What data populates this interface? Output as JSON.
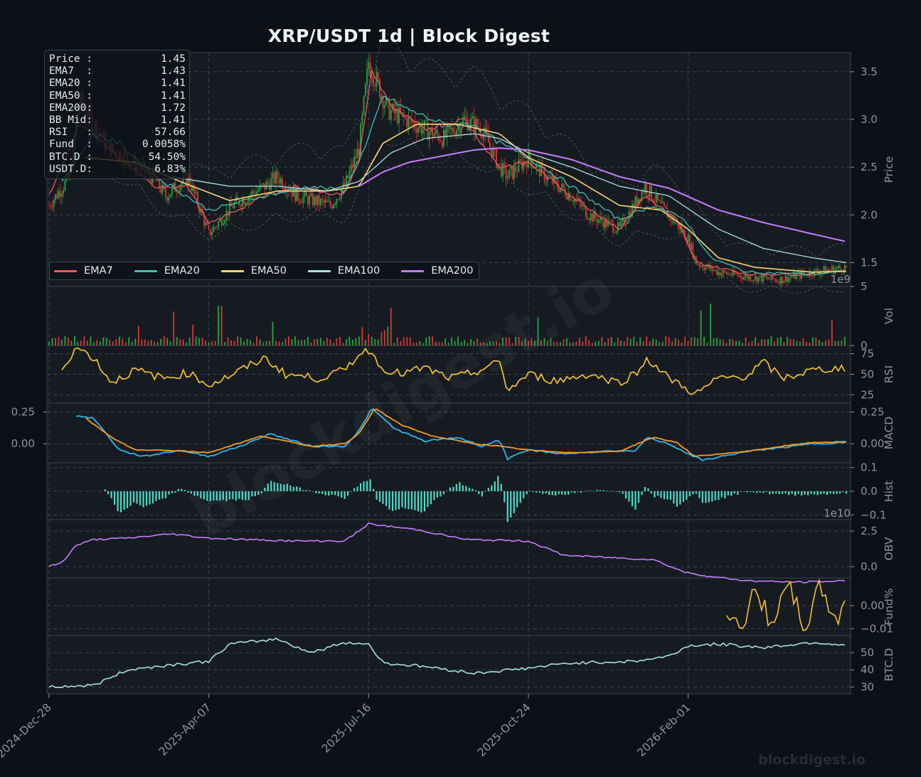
{
  "title": "XRP/USDT  1d  |  Block Digest",
  "watermark": "blockdigest.io",
  "colors": {
    "background": "#0d1117",
    "panel": "#161b22",
    "grid": "#39414b",
    "text": "#8b949e",
    "up_candle": "#26a641",
    "down_candle": "#da3633",
    "ema7": "#f05a5a",
    "ema20": "#3ec1b4",
    "ema50": "#f8d66d",
    "ema100": "#a8e1dc",
    "ema200": "#c67cff",
    "rsi": "#f2c12e",
    "macd": "#27b8f0",
    "signal": "#f79a1c",
    "hist": "#4ed9c5",
    "obv": "#c67cff",
    "funding": "#f2c12e",
    "btcd": "#a8e1dc"
  },
  "info_box": {
    "rows": [
      {
        "label": "Price :",
        "value": "1.45"
      },
      {
        "label": "EMA7  :",
        "value": "1.43"
      },
      {
        "label": "EMA20 :",
        "value": "1.41"
      },
      {
        "label": "EMA50 :",
        "value": "1.41"
      },
      {
        "label": "EMA200:",
        "value": "1.72"
      },
      {
        "label": "BB Mid:",
        "value": "1.41"
      },
      {
        "label": "RSI   :",
        "value": "57.66"
      },
      {
        "label": "Fund  :",
        "value": "0.0058%"
      },
      {
        "label": "BTC.D :",
        "value": "54.50%"
      },
      {
        "label": "USDT.D:",
        "value": "6.83%"
      }
    ]
  },
  "legend": [
    "EMA7",
    "EMA20",
    "EMA50",
    "EMA100",
    "EMA200"
  ],
  "chart_data": {
    "type": "line",
    "x_tick_labels": [
      "2024-Dec-28",
      "2025-Apr-07",
      "2025-Jul-16",
      "2025-Oct-24",
      "2026-Feb-01"
    ],
    "grid": true,
    "legend_position": "lower-left",
    "panels": [
      {
        "name": "price",
        "ylabel": "Price",
        "ylim": [
          1.25,
          3.7
        ],
        "ticks": [
          1.5,
          2.0,
          2.5,
          3.0,
          3.5
        ],
        "tick_labels": [
          "1.5",
          "2.0",
          "2.5",
          "3.0",
          "3.5"
        ],
        "close_series": {
          "name": "Close",
          "x": [
            "2024-12-28",
            "2025-01-10",
            "2025-01-16",
            "2025-01-27",
            "2025-02-03",
            "2025-02-14",
            "2025-03-03",
            "2025-03-11",
            "2025-03-25",
            "2025-04-07",
            "2025-04-22",
            "2025-05-12",
            "2025-05-20",
            "2025-06-01",
            "2025-06-22",
            "2025-07-01",
            "2025-07-10",
            "2025-07-16",
            "2025-07-21",
            "2025-07-28",
            "2025-08-08",
            "2025-08-20",
            "2025-09-01",
            "2025-09-14",
            "2025-09-25",
            "2025-10-06",
            "2025-10-11",
            "2025-10-24",
            "2025-11-04",
            "2025-11-20",
            "2025-12-01",
            "2025-12-20",
            "2026-01-05",
            "2026-01-14",
            "2026-01-25",
            "2026-02-01",
            "2026-02-06",
            "2026-02-20",
            "2026-03-10",
            "2026-03-30",
            "2026-04-20",
            "2026-05-11"
          ],
          "values": [
            2.1,
            2.4,
            3.2,
            2.9,
            2.7,
            2.6,
            2.4,
            2.2,
            2.4,
            1.8,
            2.1,
            2.3,
            2.4,
            2.2,
            2.1,
            2.3,
            2.7,
            3.6,
            3.4,
            3.1,
            3.0,
            2.9,
            2.8,
            3.0,
            2.9,
            2.5,
            2.4,
            2.6,
            2.4,
            2.2,
            2.0,
            1.85,
            2.3,
            2.1,
            1.9,
            1.75,
            1.5,
            1.4,
            1.35,
            1.32,
            1.4,
            1.45
          ]
        },
        "series": [
          {
            "name": "EMA7",
            "x": [
              "2024-12-28",
              "2025-01-16",
              "2025-02-03",
              "2025-03-03",
              "2025-03-25",
              "2025-04-07",
              "2025-05-12",
              "2025-06-01",
              "2025-07-01",
              "2025-07-10",
              "2025-07-18",
              "2025-08-01",
              "2025-08-20",
              "2025-09-14",
              "2025-10-06",
              "2025-10-24",
              "2025-11-20",
              "2025-12-20",
              "2026-01-05",
              "2026-01-25",
              "2026-02-06",
              "2026-03-10",
              "2026-04-20",
              "2026-05-11"
            ],
            "values": [
              2.2,
              2.95,
              2.7,
              2.3,
              2.3,
              1.9,
              2.2,
              2.3,
              2.2,
              2.6,
              3.5,
              3.1,
              2.9,
              3.0,
              2.5,
              2.55,
              2.2,
              1.85,
              2.2,
              1.95,
              1.5,
              1.38,
              1.38,
              1.43
            ]
          },
          {
            "name": "EMA20",
            "x": [
              "2025-01-05",
              "2025-01-25",
              "2025-02-10",
              "2025-03-05",
              "2025-04-07",
              "2025-05-12",
              "2025-06-10",
              "2025-07-01",
              "2025-07-15",
              "2025-07-25",
              "2025-08-10",
              "2025-09-01",
              "2025-09-20",
              "2025-10-06",
              "2025-10-24",
              "2025-11-20",
              "2025-12-20",
              "2026-01-10",
              "2026-01-30",
              "2026-02-15",
              "2026-03-10",
              "2026-04-20",
              "2026-05-11"
            ],
            "values": [
              2.35,
              2.85,
              2.75,
              2.4,
              2.05,
              2.2,
              2.3,
              2.25,
              2.75,
              3.25,
              3.1,
              2.95,
              2.95,
              2.75,
              2.6,
              2.3,
              1.95,
              2.1,
              1.95,
              1.55,
              1.4,
              1.38,
              1.41
            ]
          },
          {
            "name": "EMA50",
            "x": [
              "2025-01-20",
              "2025-02-20",
              "2025-03-20",
              "2025-04-20",
              "2025-05-20",
              "2025-06-20",
              "2025-07-10",
              "2025-07-25",
              "2025-08-15",
              "2025-09-10",
              "2025-10-06",
              "2025-10-24",
              "2025-11-20",
              "2025-12-20",
              "2026-01-15",
              "2026-02-01",
              "2026-02-20",
              "2026-03-15",
              "2026-04-20",
              "2026-05-11"
            ],
            "values": [
              2.6,
              2.55,
              2.35,
              2.15,
              2.25,
              2.25,
              2.3,
              2.75,
              2.95,
              2.95,
              2.85,
              2.6,
              2.4,
              2.1,
              2.05,
              1.85,
              1.55,
              1.45,
              1.4,
              1.41
            ]
          },
          {
            "name": "EMA100",
            "x": [
              "2025-03-15",
              "2025-04-20",
              "2025-05-20",
              "2025-06-20",
              "2025-07-10",
              "2025-07-30",
              "2025-08-20",
              "2025-09-20",
              "2025-10-06",
              "2025-10-24",
              "2025-11-20",
              "2025-12-20",
              "2026-01-20",
              "2026-02-20",
              "2026-03-20",
              "2026-04-20",
              "2026-05-11"
            ],
            "values": [
              2.4,
              2.3,
              2.3,
              2.25,
              2.35,
              2.65,
              2.8,
              2.85,
              2.8,
              2.65,
              2.5,
              2.3,
              2.2,
              1.85,
              1.65,
              1.55,
              1.5
            ]
          },
          {
            "name": "EMA200",
            "x": [
              "2025-07-10",
              "2025-07-25",
              "2025-08-10",
              "2025-09-01",
              "2025-09-20",
              "2025-10-06",
              "2025-10-24",
              "2025-11-20",
              "2025-12-20",
              "2026-01-20",
              "2026-02-20",
              "2026-03-20",
              "2026-04-20",
              "2026-05-11"
            ],
            "values": [
              2.3,
              2.45,
              2.55,
              2.62,
              2.68,
              2.7,
              2.68,
              2.58,
              2.4,
              2.28,
              2.05,
              1.92,
              1.8,
              1.72
            ]
          }
        ],
        "multiplier_label": "1e9"
      },
      {
        "name": "volume",
        "ylabel": "Vol",
        "ylim": [
          0,
          5
        ],
        "ticks": [
          0,
          5
        ],
        "tick_labels": [
          "0",
          "5"
        ],
        "unit": "1e9"
      },
      {
        "name": "rsi",
        "ylabel": "RSI",
        "ylim": [
          15,
          85
        ],
        "ticks": [
          25,
          50,
          75
        ],
        "tick_labels": [
          "25",
          "50",
          "75"
        ],
        "series": [
          {
            "name": "RSI",
            "x": [
              "2025-01-05",
              "2025-01-14",
              "2025-01-25",
              "2025-02-05",
              "2025-02-20",
              "2025-03-10",
              "2025-03-25",
              "2025-04-07",
              "2025-04-20",
              "2025-05-12",
              "2025-05-25",
              "2025-06-15",
              "2025-07-01",
              "2025-07-10",
              "2025-07-18",
              "2025-07-22",
              "2025-08-05",
              "2025-08-20",
              "2025-09-05",
              "2025-09-20",
              "2025-10-06",
              "2025-10-11",
              "2025-10-24",
              "2025-11-10",
              "2025-12-01",
              "2025-12-20",
              "2026-01-02",
              "2026-01-06",
              "2026-01-20",
              "2026-02-01",
              "2026-02-05",
              "2026-02-20",
              "2026-03-10",
              "2026-03-20",
              "2026-04-01",
              "2026-04-20",
              "2026-05-11"
            ],
            "values": [
              57,
              83,
              70,
              40,
              55,
              45,
              52,
              37,
              48,
              70,
              50,
              45,
              55,
              75,
              80,
              60,
              50,
              58,
              45,
              52,
              65,
              30,
              50,
              42,
              50,
              40,
              55,
              70,
              45,
              32,
              25,
              45,
              48,
              65,
              45,
              55,
              58
            ]
          }
        ]
      },
      {
        "name": "macd",
        "ylabel": "MACD",
        "ylim": [
          -0.15,
          0.32
        ],
        "ticks": [
          0.0,
          0.25
        ],
        "tick_labels": [
          "0.00",
          "0.25"
        ],
        "series": [
          {
            "name": "MACD",
            "x": [
              "2025-01-14",
              "2025-01-25",
              "2025-02-10",
              "2025-02-25",
              "2025-03-20",
              "2025-04-07",
              "2025-05-01",
              "2025-05-15",
              "2025-06-10",
              "2025-07-01",
              "2025-07-10",
              "2025-07-18",
              "2025-08-01",
              "2025-08-20",
              "2025-09-10",
              "2025-09-25",
              "2025-10-06",
              "2025-10-11",
              "2025-10-24",
              "2025-11-15",
              "2025-12-10",
              "2025-12-30",
              "2026-01-06",
              "2026-01-20",
              "2026-02-01",
              "2026-02-10",
              "2026-03-10",
              "2026-04-01",
              "2026-04-20",
              "2026-05-11"
            ],
            "values": [
              0.22,
              0.2,
              -0.05,
              -0.1,
              -0.05,
              -0.1,
              0.0,
              0.08,
              -0.02,
              -0.02,
              0.1,
              0.28,
              0.12,
              0.02,
              0.05,
              -0.02,
              0.03,
              -0.12,
              -0.05,
              -0.08,
              -0.06,
              -0.06,
              0.05,
              0.0,
              -0.08,
              -0.13,
              -0.06,
              -0.03,
              0.0,
              0.01
            ]
          },
          {
            "name": "Signal",
            "x": [
              "2025-01-20",
              "2025-02-05",
              "2025-02-20",
              "2025-03-10",
              "2025-04-07",
              "2025-05-10",
              "2025-06-10",
              "2025-07-01",
              "2025-07-10",
              "2025-07-20",
              "2025-08-05",
              "2025-08-25",
              "2025-09-20",
              "2025-10-06",
              "2025-10-24",
              "2025-11-20",
              "2025-12-20",
              "2026-01-10",
              "2026-01-25",
              "2026-02-05",
              "2026-03-10",
              "2026-04-01",
              "2026-04-20",
              "2026-05-11"
            ],
            "values": [
              0.2,
              0.05,
              -0.05,
              -0.05,
              -0.07,
              0.06,
              -0.02,
              0.0,
              0.08,
              0.28,
              0.15,
              0.06,
              0.0,
              -0.02,
              -0.05,
              -0.07,
              -0.06,
              0.05,
              0.01,
              -0.1,
              -0.06,
              -0.02,
              0.01,
              0.015
            ]
          }
        ]
      },
      {
        "name": "hist",
        "ylabel": "Hist",
        "ylim": [
          -0.12,
          0.12
        ],
        "ticks": [
          -0.1,
          0.0,
          0.1
        ],
        "tick_labels": [
          "−0.1",
          "0.0",
          "0.1"
        ]
      },
      {
        "name": "obv",
        "ylabel": "OBV",
        "ylim": [
          -0.8,
          3.3
        ],
        "ticks": [
          0.0,
          2.5
        ],
        "tick_labels": [
          "0.0",
          "2.5"
        ],
        "unit": "1e10",
        "series": [
          {
            "name": "OBV",
            "x": [
              "2024-12-28",
              "2025-01-05",
              "2025-01-14",
              "2025-01-25",
              "2025-02-15",
              "2025-03-15",
              "2025-04-07",
              "2025-05-01",
              "2025-06-01",
              "2025-07-01",
              "2025-07-10",
              "2025-07-16",
              "2025-08-15",
              "2025-09-15",
              "2025-10-24",
              "2025-11-15",
              "2025-12-20",
              "2026-01-10",
              "2026-01-30",
              "2026-02-15",
              "2026-03-10",
              "2026-04-10",
              "2026-05-11"
            ],
            "values": [
              0.0,
              0.3,
              1.5,
              1.9,
              2.0,
              2.3,
              2.0,
              1.9,
              1.8,
              1.8,
              2.5,
              3.0,
              2.6,
              1.9,
              1.8,
              0.8,
              0.6,
              0.5,
              -0.4,
              -0.7,
              -1.0,
              -1.1,
              -1.0
            ]
          }
        ]
      },
      {
        "name": "funding",
        "ylabel": "Fund%",
        "ylim": [
          -0.013,
          0.012
        ],
        "ticks": [
          -0.01,
          0.0
        ],
        "tick_labels": [
          "−0.01",
          "0.00"
        ],
        "series": [
          {
            "name": "Funding",
            "x": [
              "2026-02-25",
              "2026-03-05",
              "2026-03-15",
              "2026-03-25",
              "2026-04-05",
              "2026-04-15",
              "2026-04-25",
              "2026-05-05",
              "2026-05-11"
            ],
            "values": [
              0.0,
              -0.01,
              0.005,
              -0.006,
              0.007,
              -0.009,
              0.008,
              -0.007,
              0.0058
            ]
          }
        ]
      },
      {
        "name": "btcd",
        "ylabel": "BTC.D",
        "ylim": [
          26,
          60
        ],
        "ticks": [
          30,
          40,
          50
        ],
        "tick_labels": [
          "30",
          "40",
          "50"
        ],
        "series": [
          {
            "name": "BTC.D",
            "x": [
              "2024-12-28",
              "2025-01-25",
              "2025-02-15",
              "2025-03-15",
              "2025-04-07",
              "2025-04-20",
              "2025-05-20",
              "2025-06-10",
              "2025-07-01",
              "2025-07-16",
              "2025-07-25",
              "2025-08-20",
              "2025-09-20",
              "2025-10-24",
              "2025-11-20",
              "2025-12-30",
              "2026-01-20",
              "2026-02-01",
              "2026-02-20",
              "2026-03-20",
              "2026-04-20",
              "2026-05-11"
            ],
            "values": [
              30,
              31,
              40,
              43,
              45,
              55,
              58,
              50,
              56,
              55,
              44,
              42,
              38,
              41,
              44,
              45,
              48,
              54,
              55,
              53,
              56,
              54.5
            ]
          }
        ]
      }
    ]
  }
}
